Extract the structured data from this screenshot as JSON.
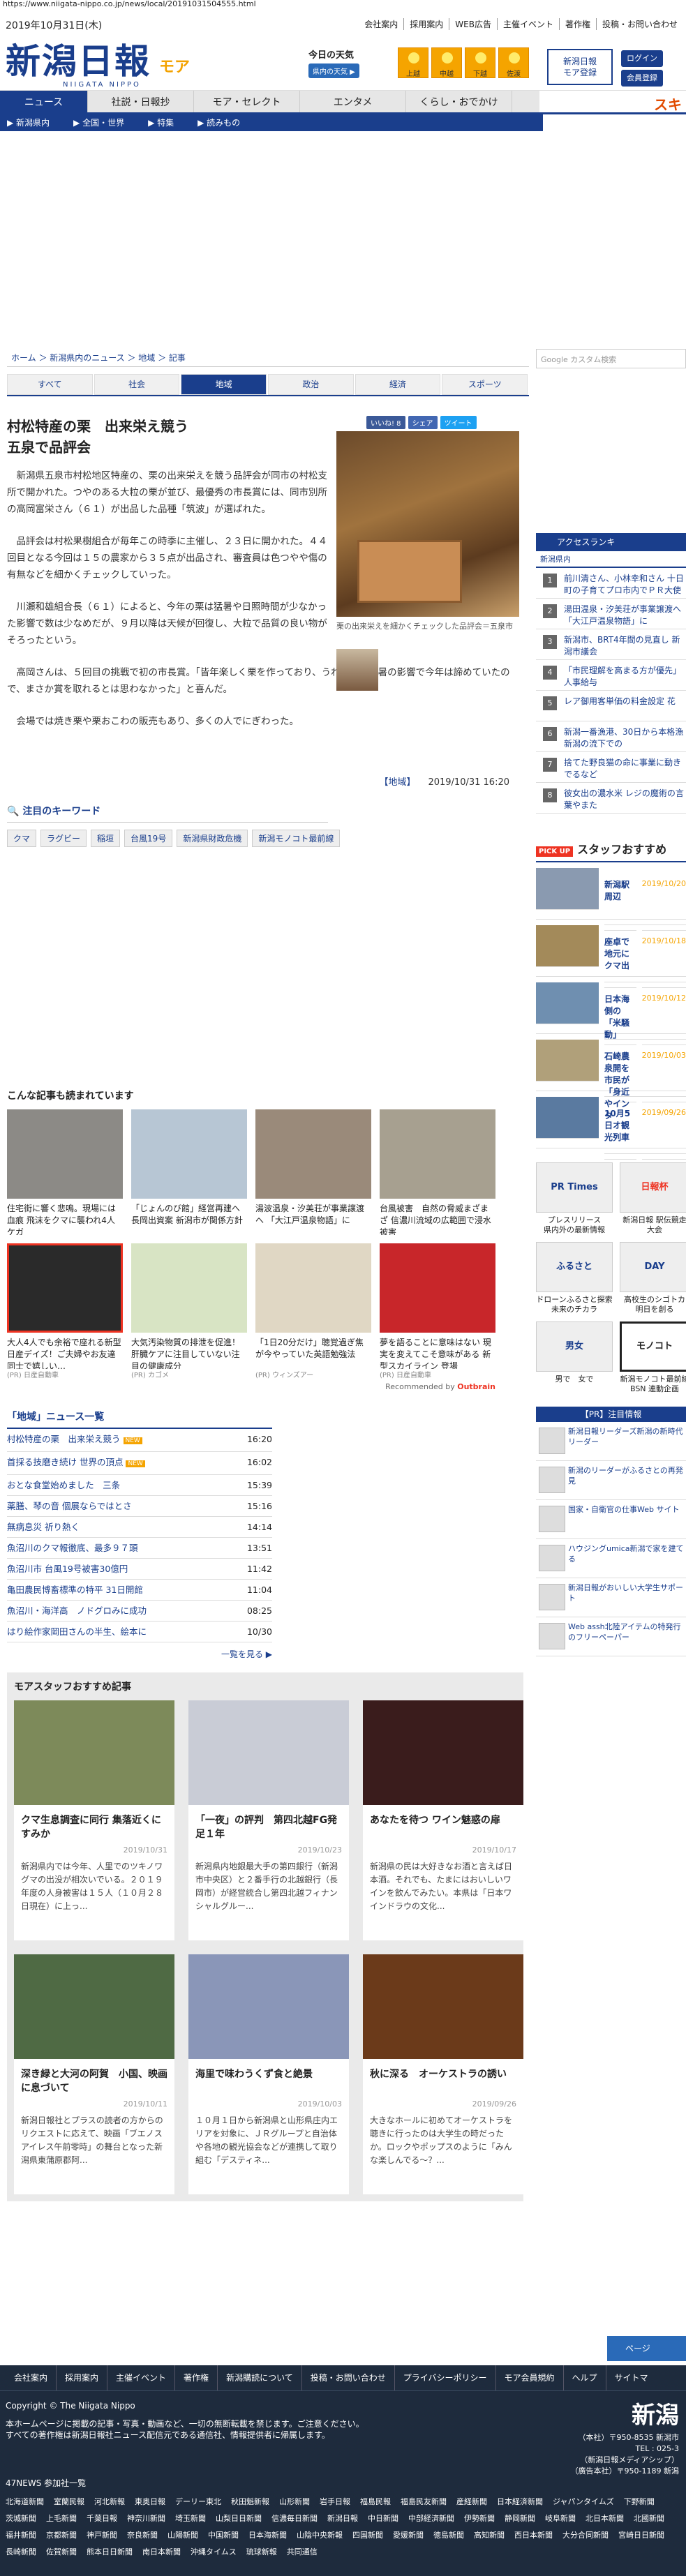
{
  "url": "https://www.niigata-nippo.co.jp/news/local/20191031504555.html",
  "header": {
    "date": "2019年10月31日(木)",
    "toplinks": [
      "会社案内",
      "採用案内",
      "WEB広告",
      "主催イベント",
      "著作権",
      "投稿・お問い合わせ"
    ],
    "logo_jp": "新潟日報",
    "logo_en": "NIIGATA NIPPO",
    "logo_moa": "モア",
    "weather_title": "今日の天気",
    "weather_btn": "県内の天気 ▶",
    "weather": [
      {
        "area": "上越"
      },
      {
        "area": "中越"
      },
      {
        "area": "下越"
      },
      {
        "area": "佐渡"
      }
    ],
    "register": "新潟日報\nモア登録",
    "login": [
      "ログイン",
      "会員登録"
    ]
  },
  "nav": {
    "items": [
      "ニュース",
      "社説・日報抄",
      "モア・セレクト",
      "エンタメ",
      "くらし・おでかけ"
    ],
    "side": "スキ"
  },
  "subnav": [
    "▶ 新潟県内",
    "▶ 全国・世界",
    "▶ 特集",
    "▶ 読みもの"
  ],
  "breadcrumb": "ホーム ＞ 新潟県内のニュース ＞ 地域 ＞ 記事",
  "tabs": [
    "すべて",
    "社会",
    "地域",
    "政治",
    "経済",
    "スポーツ"
  ],
  "share": {
    "like": "いいね! 8",
    "share": "シェア",
    "tweet": "ツイート"
  },
  "article": {
    "title": "村松特産の栗　出来栄え競う\n五泉で品評会",
    "p1": "新潟県五泉市村松地区特産の、栗の出来栄えを競う品評会が同市の村松支所で開かれた。つやのある大粒の栗が並び、最優秀の市長賞には、同市別所の高岡富栄さん（６１）が出品した品種「筑波」が選ばれた。",
    "p2": "品評会は村松果樹組合が毎年この時季に主催し、２３日に開かれた。４４回目となる今回は１５の農家から３５点が出品され、審査員は色つやや傷の有無などを細かくチェックしていった。",
    "p3": "川瀬和雄組合長（６１）によると、今年の栗は猛暑や日照時間が少なかった影響で数は少なめだが、９月以降は天候が回復し、大粒で品質の良い物がそろったという。",
    "p4": "高岡さんは、５回目の挑戦で初の市長賞。「皆年楽しく栗を作っており、うれしい。猛暑の影響で今年は諦めていたので、まさか賞を取れるとは思わなかった」と喜んだ。",
    "p5": "会場では焼き栗や栗おこわの販売もあり、多くの人でにぎわった。",
    "caption": "栗の出来栄えを細かくチェックした品評会＝五泉市",
    "tag": "【地域】",
    "time": "2019/10/31 16:20"
  },
  "keywords": {
    "heading": "注目のキーワード",
    "items": [
      "クマ",
      "ラグビー",
      "稲垣",
      "台風19号",
      "新潟県財政危機",
      "新潟モノコト最前線"
    ]
  },
  "reco": {
    "heading": "こんな記事も読まれています",
    "items": [
      {
        "t": "住宅街に響く悲鳴。現場には血痕 飛沫をクマに襲われ4人ケガ",
        "s": ""
      },
      {
        "t": "「じょんのび館」経営再建へ 長岡出資案 新潟市が関係方針",
        "s": ""
      },
      {
        "t": "湯波温泉・汐美荘が事業譲渡へ 「大江戸温泉物語」に",
        "s": ""
      },
      {
        "t": "台風被害　自然の脅威まざまざ 信濃川流域の広範囲で浸水被害",
        "s": ""
      },
      {
        "t": "大人4人でも余裕で座れる新型日産デイズ！ご夫婦やお友達同士で嬉しい…",
        "s": "(PR) 日産自動車"
      },
      {
        "t": "大気汚染物質の排泄を促進！肝臓ケアに注目していない注目の健康成分",
        "s": "(PR) カゴメ"
      },
      {
        "t": "「1日20分だけ」聴覚過ぎ焦が今やっていた英語勉強法",
        "s": "(PR) ウィンズアー"
      },
      {
        "t": "夢を語ることに意味はない 現実を変えてこそ意味がある 新型スカイライン 登場",
        "s": "(PR) 日産自動車"
      }
    ],
    "outbrain": "Recommended by",
    "outbrain_b": "Outbrain"
  },
  "newslist": {
    "heading": "「地域」ニュース一覧",
    "items": [
      {
        "t": "村松特産の栗　出来栄え競う",
        "d": "16:20",
        "n": true
      },
      {
        "t": "首採る技磨き続け 世界の頂点",
        "d": "16:02",
        "n": true
      },
      {
        "t": "おとな食堂始めました　三条",
        "d": "15:39",
        "n": false
      },
      {
        "t": "薬膳、琴の音 個展ならではとさ",
        "d": "15:16",
        "n": false
      },
      {
        "t": "無病息災 祈り熱く",
        "d": "14:14",
        "n": false
      },
      {
        "t": "魚沼川のクマ報徹底、最多９７頭",
        "d": "13:51",
        "n": false
      },
      {
        "t": "魚沼川市 台風19号被害30億円",
        "d": "11:42",
        "n": false
      },
      {
        "t": "亀田農民博畜標準の特平 31日開館",
        "d": "11:04",
        "n": false
      },
      {
        "t": "魚沼川・海洋高　ノドグロみに成功",
        "d": "08:25",
        "n": false
      },
      {
        "t": "はり絵作家岡田さんの半生、絵本に",
        "d": "10/30",
        "n": false
      }
    ],
    "more": "一覧を見る ▶"
  },
  "staff": {
    "heading": "モアスタッフおすすめ記事",
    "items": [
      {
        "t": "クマ生息調査に同行 集落近くにすみか",
        "d": "2019/10/31",
        "x": "新潟県内では今年、人里でのツキノワグマの出没が相次いでいる。２０１９年度の人身被害は１５人（１０月２８日現在）に上っ..."
      },
      {
        "t": "「一夜」の評判　第四北越FG発足１年",
        "d": "2019/10/23",
        "x": "新潟県内地銀最大手の第四銀行（新潟市中央区）と２番手行の北越銀行（長岡市）が経営統合し第四北越フィナンシャルグルー..."
      },
      {
        "t": "あなたを待つ ワイン魅惑の扉",
        "d": "2019/10/17",
        "x": "新潟県の民は大好きなお酒と言えば日本酒。それでも、たまにはおいしいワインを飲んでみたい。本県は「日本ワインドラウの文化..."
      },
      {
        "t": "深き緑と大河の阿賀　小国、映画に息づいて",
        "d": "2019/10/11",
        "x": "新潟日報社とプラスの読者の方からのリクエストに応えて、映画「ブエノスアイレス午前零時」の舞台となった新潟県東蒲原郡阿..."
      },
      {
        "t": "海里で味わうくず食と絶景",
        "d": "2019/10/03",
        "x": "１０月１日から新潟県と山形県庄内エリアを対象に、ＪＲグループと自治体や各地の観光協会などが連携して取り組む「デスティネ..."
      },
      {
        "t": "秋に深る　オーケストラの誘い",
        "d": "2019/09/26",
        "x": "大きなホールに初めてオーケストラを聴きに行ったのは大学生の時だったか。ロックやポップスのように「みんな楽しんでる～？..."
      }
    ]
  },
  "right": {
    "search": "Google カスタム検索",
    "ranking_h": "アクセスランキ",
    "ranking_tab": "新潟県内",
    "ranking": [
      "前川清さん、小林幸和さん 十日町の子育てプロ市内でＰＲ大使に",
      "湯田温泉・汐美荘が事業譲渡へ「大江戸温泉物語」に",
      "新潟市、BRT4年間の見直し 新潟市議会",
      "「市民理解を高まる方が優先」人事給与",
      "レア御用客単価の料金設定 花",
      "新潟一番漁港、30日から本格漁 新潟の流下での",
      "捨てた野良猫の命に事業に動きでるなど",
      "彼女出の濃水米 レジの魔術の言葉やまた"
    ],
    "sr_h": "スタッフおすすめ",
    "sr_pk": "PICK UP",
    "sr": [
      {
        "t": "新潟駅周辺",
        "d": "2019/10/20"
      },
      {
        "t": "座卓で地元にクマ出",
        "d": "2019/10/18"
      },
      {
        "t": "日本海側の「米騒動」",
        "d": "2019/10/12"
      },
      {
        "t": "石崎農泉開を市民が「身近やインタ",
        "d": "2019/10/03"
      },
      {
        "t": "10月5日オ観光列車",
        "d": "2019/09/26"
      }
    ],
    "banners": [
      {
        "im": "PR Times",
        "t": "プレスリリース\n県内外の最新情報"
      },
      {
        "im": "日報杯",
        "t": "新潟日報 駅伝競走大会"
      },
      {
        "im": "ふるさと",
        "t": "ドローンふるさと探索\n未来のチカラ"
      },
      {
        "im": "DAY",
        "t": "高校生のシゴトカ\n明日を創る"
      },
      {
        "im": "男女",
        "t": "男で　女で"
      },
      {
        "im": "モノコト",
        "t": "新潟モノコト最前線\nBSN 連動企画"
      }
    ],
    "pr_h": "【PR】注目情報",
    "pr": [
      "新潟日報リーダーズ新潟の新時代リーダー",
      "新潟のリーダーがふるさとの再発見",
      "国家・自衛官の仕事Web サイト",
      "ハウジングumica新潟で家を建てる",
      "新潟日報がおいしい大学生サポート",
      "Web assh北陸アイテムの特発行のフリーペーパー"
    ],
    "pagetop": "ページ"
  },
  "footer": {
    "links": [
      "会社案内",
      "採用案内",
      "主催イベント",
      "著作権",
      "新潟購読について",
      "投稿・お問い合わせ",
      "プライバシーポリシー",
      "モア会員規約",
      "ヘルプ",
      "サイトマ"
    ],
    "copy": "Copyright © The Niigata Nippo",
    "note1": "本ホームページに掲載の記事・写真・動画など、一切の無断転載を禁じます。ご注意ください。",
    "note2": "すべての著作権は新潟日報社ニュース配信元である通信社、情報提供者に帰属します。",
    "logo": "新潟",
    "addr": "（本社）〒950-8535 新潟市\nTEL : 025-3\n（新潟日報メディアシップ）\n（廣告本社）〒950-1189 新潟",
    "n47": "47NEWS 参加社一覧",
    "papers": [
      "北海道新聞",
      "室蘭民報",
      "河北新報",
      "東奥日報",
      "デーリー東北",
      "秋田魁新報",
      "山形新聞",
      "岩手日報",
      "福島民報",
      "福島民友新聞",
      "産経新聞",
      "日本経済新聞",
      "ジャパンタイムズ",
      "下野新聞",
      "茨城新聞",
      "上毛新聞",
      "千葉日報",
      "神奈川新聞",
      "埼玉新聞",
      "山梨日日新聞",
      "信濃毎日新聞",
      "新潟日報",
      "中日新聞",
      "中部経済新聞",
      "伊勢新聞",
      "静岡新聞",
      "岐阜新聞",
      "北日本新聞",
      "北國新聞",
      "福井新聞",
      "京都新聞",
      "神戸新聞",
      "奈良新聞",
      "山陽新聞",
      "中国新聞",
      "日本海新聞",
      "山陰中央新報",
      "四国新聞",
      "愛媛新聞",
      "徳島新聞",
      "高知新聞",
      "西日本新聞",
      "大分合同新聞",
      "宮崎日日新聞",
      "長崎新聞",
      "佐賀新聞",
      "熊本日日新聞",
      "南日本新聞",
      "沖縄タイムス",
      "琉球新報",
      "共同通信"
    ]
  }
}
